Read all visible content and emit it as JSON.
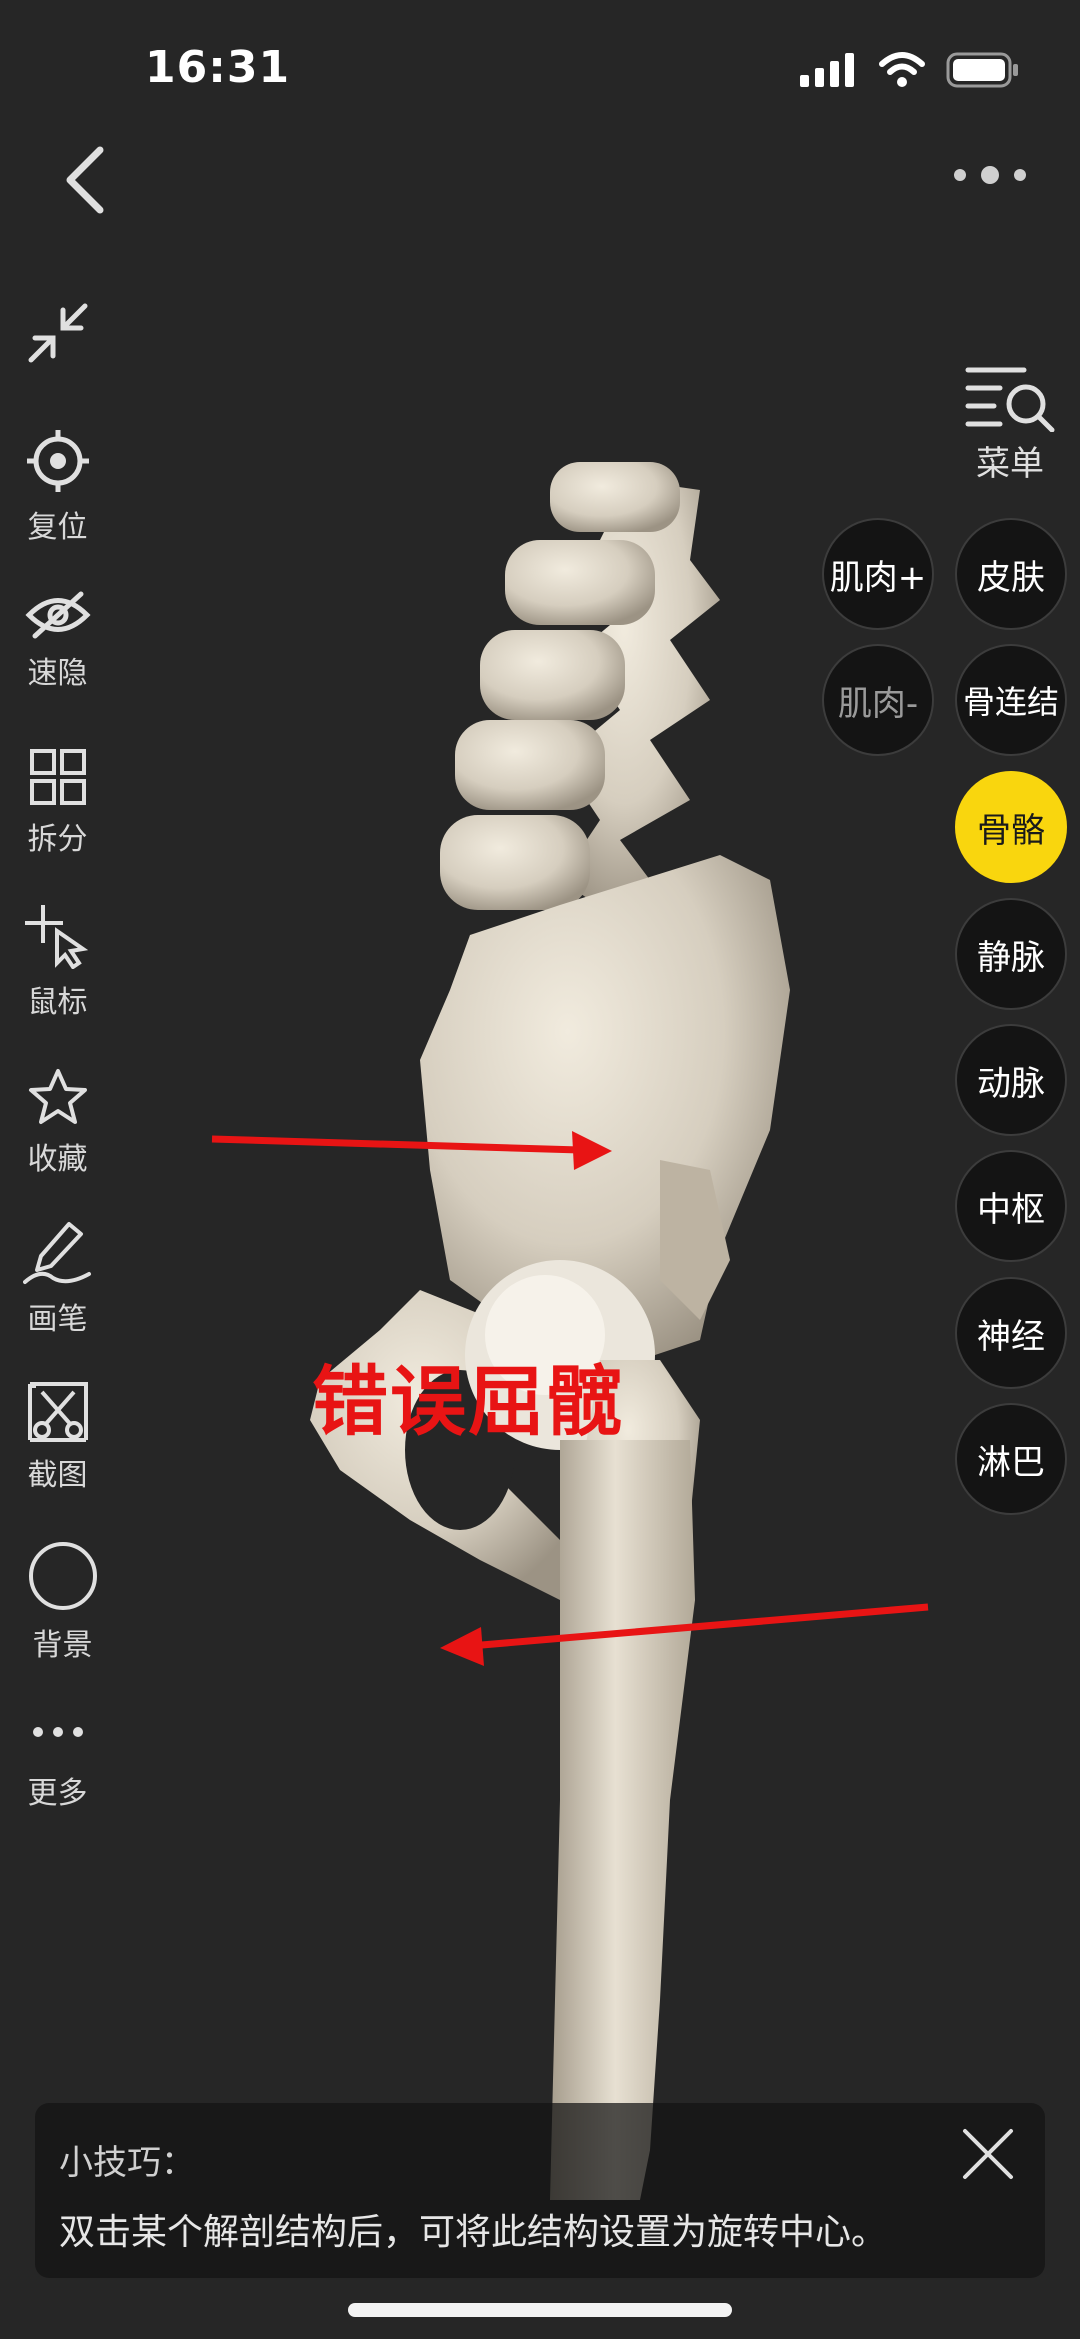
{
  "status_bar": {
    "time": "16:31",
    "icons": [
      "signal-icon",
      "wifi-icon",
      "battery-icon"
    ]
  },
  "top_bar": {
    "back_icon": "chevron-left-icon",
    "more_icon": "more-horizontal-icon"
  },
  "left_toolbar": {
    "items": [
      {
        "icon": "collapse-icon",
        "label": ""
      },
      {
        "icon": "target-icon",
        "label": "复位"
      },
      {
        "icon": "eye-off-icon",
        "label": "速隐"
      },
      {
        "icon": "split-grid-icon",
        "label": "拆分"
      },
      {
        "icon": "cursor-move-icon",
        "label": "鼠标"
      },
      {
        "icon": "star-icon",
        "label": "收藏"
      },
      {
        "icon": "pen-icon",
        "label": "画笔"
      },
      {
        "icon": "scissors-icon",
        "label": "截图"
      },
      {
        "icon": "circle-icon",
        "label": "背景"
      },
      {
        "icon": "more-dots-icon",
        "label": "更多"
      }
    ]
  },
  "right_menu": {
    "menu_icon": "list-search-icon",
    "menu_label": "菜单",
    "layers": [
      {
        "label": "肌肉+",
        "state": "normal"
      },
      {
        "label": "皮肤",
        "state": "normal"
      },
      {
        "label": "肌肉-",
        "state": "dim"
      },
      {
        "label": "骨连结",
        "state": "normal"
      },
      {
        "label": "骨骼",
        "state": "active"
      },
      {
        "label": "静脉",
        "state": "normal"
      },
      {
        "label": "动脉",
        "state": "normal"
      },
      {
        "label": "中枢",
        "state": "normal"
      },
      {
        "label": "神经",
        "state": "normal"
      },
      {
        "label": "淋巴",
        "state": "normal"
      }
    ]
  },
  "viewport": {
    "annotation_text": "错误屈髋",
    "annotation_color": "#e81414",
    "arrow_icons": [
      "arrow-right-icon",
      "arrow-left-icon"
    ]
  },
  "tip": {
    "title": "小技巧：",
    "body": "双击某个解剖结构后，可将此结构设置为旋转中心。",
    "close_icon": "close-icon"
  },
  "colors": {
    "background": "#262626",
    "active_layer": "#f9d60e",
    "bone": "#d9d2c4"
  }
}
